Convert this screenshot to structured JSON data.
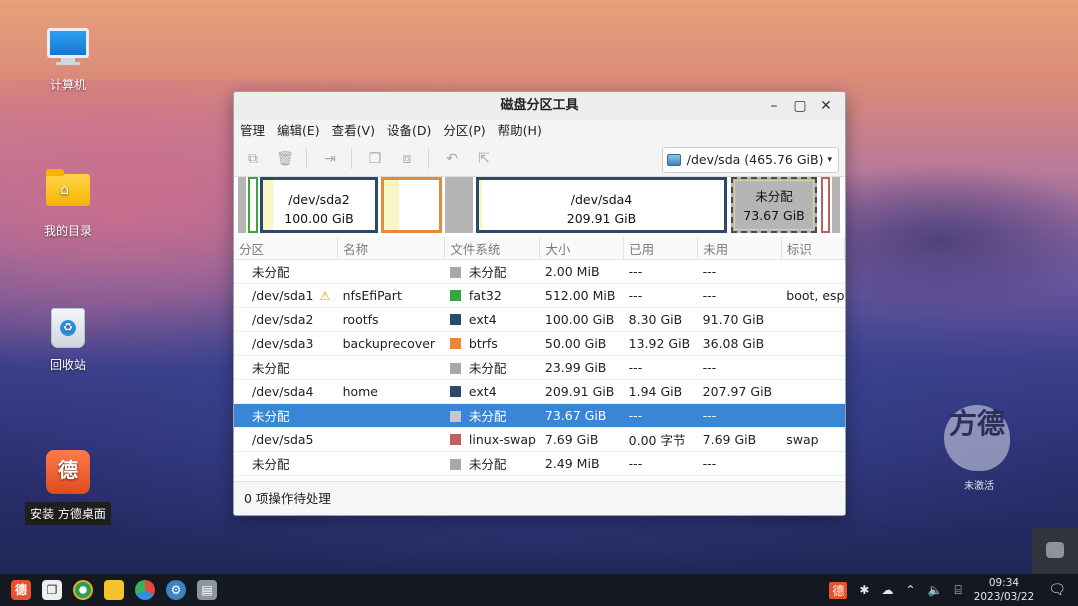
{
  "desktop": {
    "icons": [
      {
        "label": "计算机",
        "icon": "computer-icon"
      },
      {
        "label": "我的目录",
        "icon": "home-folder-icon"
      },
      {
        "label": "回收站",
        "icon": "trash-icon"
      },
      {
        "label": "安装 方德桌面",
        "icon": "installer-icon"
      }
    ],
    "watermark": {
      "mark": "方德",
      "caption": "未激活"
    }
  },
  "window": {
    "title": "磁盘分区工具",
    "controls": {
      "minimize": "–",
      "maximize": "▢",
      "close": "✕"
    },
    "menu": [
      "管理",
      "编辑(E)",
      "查看(V)",
      "设备(D)",
      "分区(P)",
      "帮助(H)"
    ],
    "device_selector": "/dev/sda  (465.76 GiB)",
    "disk_map": {
      "sda2_name": "/dev/sda2",
      "sda2_size": "100.00 GiB",
      "sda4_name": "/dev/sda4",
      "sda4_size": "209.91 GiB",
      "unalloc_name": "未分配",
      "unalloc_size": "73.67 GiB"
    },
    "columns": [
      "分区",
      "名称",
      "文件系统",
      "大小",
      "已用",
      "未用",
      "标识"
    ],
    "rows": [
      {
        "partition": "未分配",
        "name": "",
        "fs": "未分配",
        "fs_color": "#a8a8a8",
        "size": "2.00 MiB",
        "used": "---",
        "unused": "---",
        "flags": ""
      },
      {
        "partition": "/dev/sda1",
        "name": "nfsEfiPart",
        "fs": "fat32",
        "fs_color": "#3aa53a",
        "size": "512.00 MiB",
        "used": "---",
        "unused": "---",
        "flags": "boot, esp"
      },
      {
        "partition": "/dev/sda2",
        "name": "rootfs",
        "fs": "ext4",
        "fs_color": "#2a4a6a",
        "size": "100.00 GiB",
        "used": "8.30 GiB",
        "unused": "91.70 GiB",
        "flags": ""
      },
      {
        "partition": "/dev/sda3",
        "name": "backuprecover",
        "fs": "btrfs",
        "fs_color": "#e58a3b",
        "size": "50.00 GiB",
        "used": "13.92 GiB",
        "unused": "36.08 GiB",
        "flags": ""
      },
      {
        "partition": "未分配",
        "name": "",
        "fs": "未分配",
        "fs_color": "#a8a8a8",
        "size": "23.99 GiB",
        "used": "---",
        "unused": "---",
        "flags": ""
      },
      {
        "partition": "/dev/sda4",
        "name": "home",
        "fs": "ext4",
        "fs_color": "#2a4a6a",
        "size": "209.91 GiB",
        "used": "1.94 GiB",
        "unused": "207.97 GiB",
        "flags": ""
      },
      {
        "partition": "未分配",
        "name": "",
        "fs": "未分配",
        "fs_color": "#c8c8c8",
        "size": "73.67 GiB",
        "used": "---",
        "unused": "---",
        "flags": ""
      },
      {
        "partition": "/dev/sda5",
        "name": "",
        "fs": "linux-swap",
        "fs_color": "#c0605a",
        "size": "7.69 GiB",
        "used": "0.00 字节",
        "unused": "7.69 GiB",
        "flags": "swap"
      },
      {
        "partition": "未分配",
        "name": "",
        "fs": "未分配",
        "fs_color": "#a8a8a8",
        "size": "2.49 MiB",
        "used": "---",
        "unused": "---",
        "flags": ""
      }
    ],
    "status": "0 项操作待处理"
  },
  "taskbar": {
    "time": "09:34",
    "date": "2023/03/22"
  }
}
